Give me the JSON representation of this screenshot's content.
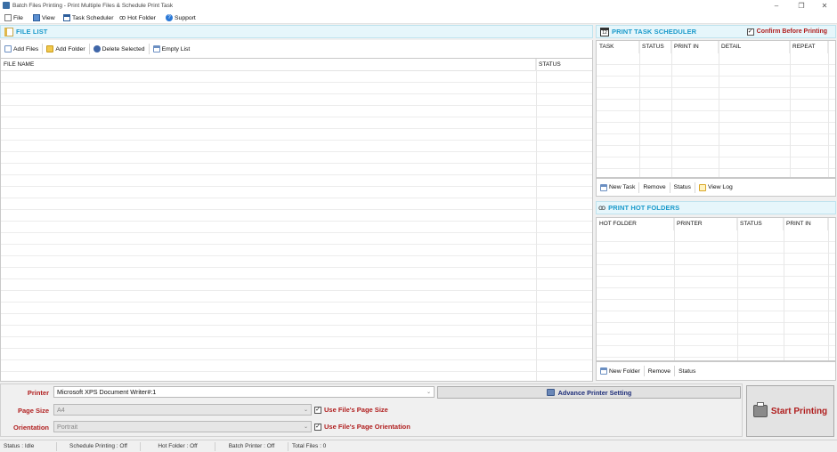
{
  "window": {
    "title": "Batch Files Printing - Print Multiple Files & Schedule Print Task",
    "controls": {
      "minimize": "–",
      "maximize": "❐",
      "close": "✕"
    }
  },
  "menu": {
    "items": [
      {
        "label": "File",
        "icon": "file-icon"
      },
      {
        "label": "View",
        "icon": "view-icon"
      },
      {
        "label": "Task Scheduler",
        "icon": "calendar-icon"
      },
      {
        "label": "Hot Folder",
        "icon": "glasses-icon"
      },
      {
        "label": "Support",
        "icon": "help-icon"
      }
    ]
  },
  "file_list": {
    "header": "FILE LIST",
    "toolbar": [
      "Add Files",
      "Add Folder",
      "Delete Selected",
      "Empty List"
    ],
    "columns": [
      "FILE NAME",
      "STATUS"
    ],
    "rows": []
  },
  "scheduler": {
    "header": "PRINT TASK SCHEDULER",
    "confirm_label": "Confirm Before Printing",
    "confirm_checked": true,
    "columns": [
      "TASK",
      "STATUS",
      "PRINT IN",
      "DETAIL",
      "REPEAT"
    ],
    "rows": [],
    "toolbar": [
      "New Task",
      "Remove",
      "Status",
      "View Log"
    ]
  },
  "hot_folders": {
    "header": "PRINT HOT FOLDERS",
    "columns": [
      "HOT FOLDER",
      "PRINTER",
      "STATUS",
      "PRINT IN"
    ],
    "rows": [],
    "toolbar": [
      "New Folder",
      "Remove",
      "Status"
    ]
  },
  "settings": {
    "printer_label": "Printer",
    "printer_value": "Microsoft XPS Document Writer#:1",
    "advance_label": "Advance Printer Setting",
    "page_size_label": "Page Size",
    "page_size_value": "A4",
    "use_page_size_label": "Use File's Page Size",
    "use_page_size_checked": true,
    "orientation_label": "Orientation",
    "orientation_value": "Portrait",
    "use_orientation_label": "Use File's Page Orientation",
    "use_orientation_checked": true,
    "start_label": "Start Printing"
  },
  "status_bar": {
    "status": "Status : Idle",
    "schedule": "Schedule Printing : Off",
    "hot_folder": "Hot Folder : Off",
    "batch_printer": "Batch Printer : Off",
    "total_files": "Total Files :  0"
  },
  "colors": {
    "header_text": "#1a9acb",
    "header_bg": "#e6f6fb",
    "label_red": "#b01e1e",
    "accent_navy": "#1f2f7a"
  }
}
